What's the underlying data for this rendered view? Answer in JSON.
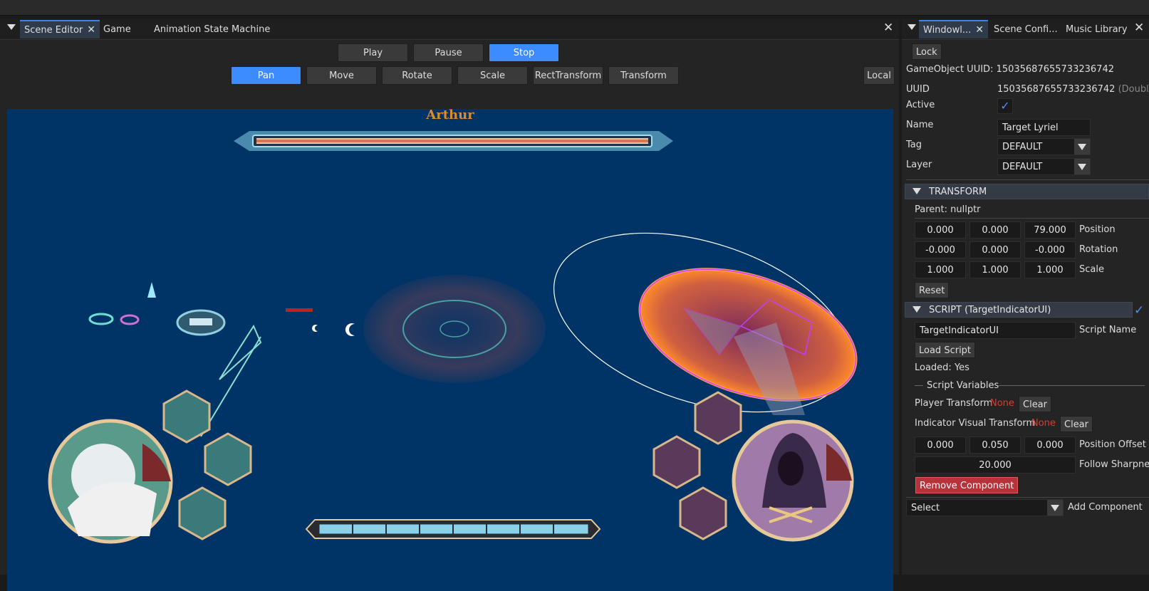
{
  "left_panel": {
    "tabs": [
      {
        "label": "Scene Editor",
        "active": true,
        "closable": true
      },
      {
        "label": "Game",
        "active": false,
        "closable": false
      },
      {
        "label": "Animation State Machine",
        "active": false,
        "closable": false
      }
    ],
    "playback": {
      "play": "Play",
      "pause": "Pause",
      "stop": "Stop",
      "active": "Stop"
    },
    "tools": [
      "Pan",
      "Move",
      "Rotate",
      "Scale",
      "RectTransform",
      "Transform"
    ],
    "active_tool": "Pan",
    "space_button": "Local"
  },
  "game_view": {
    "boss_name": "Arthur",
    "colors": {
      "background": "#003366",
      "boss_name": "#e08a2a",
      "ring_orange": "#ff8a2a",
      "ring_magenta": "#d040ff"
    }
  },
  "right_panel": {
    "tabs": [
      {
        "label": "Windowl...",
        "active": true
      },
      {
        "label": "Scene Confi...",
        "active": false
      },
      {
        "label": "Music Library",
        "active": false
      }
    ],
    "lock_button": "Lock",
    "gameobject_uuid": "GameObject UUID: 15035687655733236742",
    "uuid_label": "UUID",
    "uuid_value": "15035687655733236742",
    "uuid_hint": "(Double-c",
    "active_label": "Active",
    "active_checked": true,
    "name_label": "Name",
    "name_value": "Target Lyriel",
    "tag_label": "Tag",
    "tag_value": "DEFAULT",
    "layer_label": "Layer",
    "layer_value": "DEFAULT",
    "transform": {
      "header": "TRANSFORM",
      "parent": "Parent: nullptr",
      "position": {
        "label": "Position",
        "x": "0.000",
        "y": "0.000",
        "z": "79.000"
      },
      "rotation": {
        "label": "Rotation",
        "x": "-0.000",
        "y": "0.000",
        "z": "-0.000"
      },
      "scale": {
        "label": "Scale",
        "x": "1.000",
        "y": "1.000",
        "z": "1.000"
      },
      "reset": "Reset"
    },
    "script": {
      "header": "SCRIPT (TargetIndicatorUI)",
      "enabled": true,
      "script_name_value": "TargetIndicatorUI",
      "script_name_label": "Script Name",
      "load_button": "Load Script",
      "loaded": "Loaded: Yes",
      "variables_header": "Script Variables",
      "player_transform": {
        "label": "Player Transform",
        "value": "None",
        "clear": "Clear"
      },
      "indicator_transform": {
        "label": "Indicator Visual Transform",
        "value": "None",
        "clear": "Clear"
      },
      "position_offset": {
        "label": "Position Offset",
        "x": "0.000",
        "y": "0.050",
        "z": "0.000"
      },
      "follow_sharpness": {
        "label": "Follow Sharpnes",
        "value": "20.000"
      },
      "remove_button": "Remove Component"
    },
    "add_component": {
      "select": "Select",
      "label": "Add Component"
    }
  }
}
